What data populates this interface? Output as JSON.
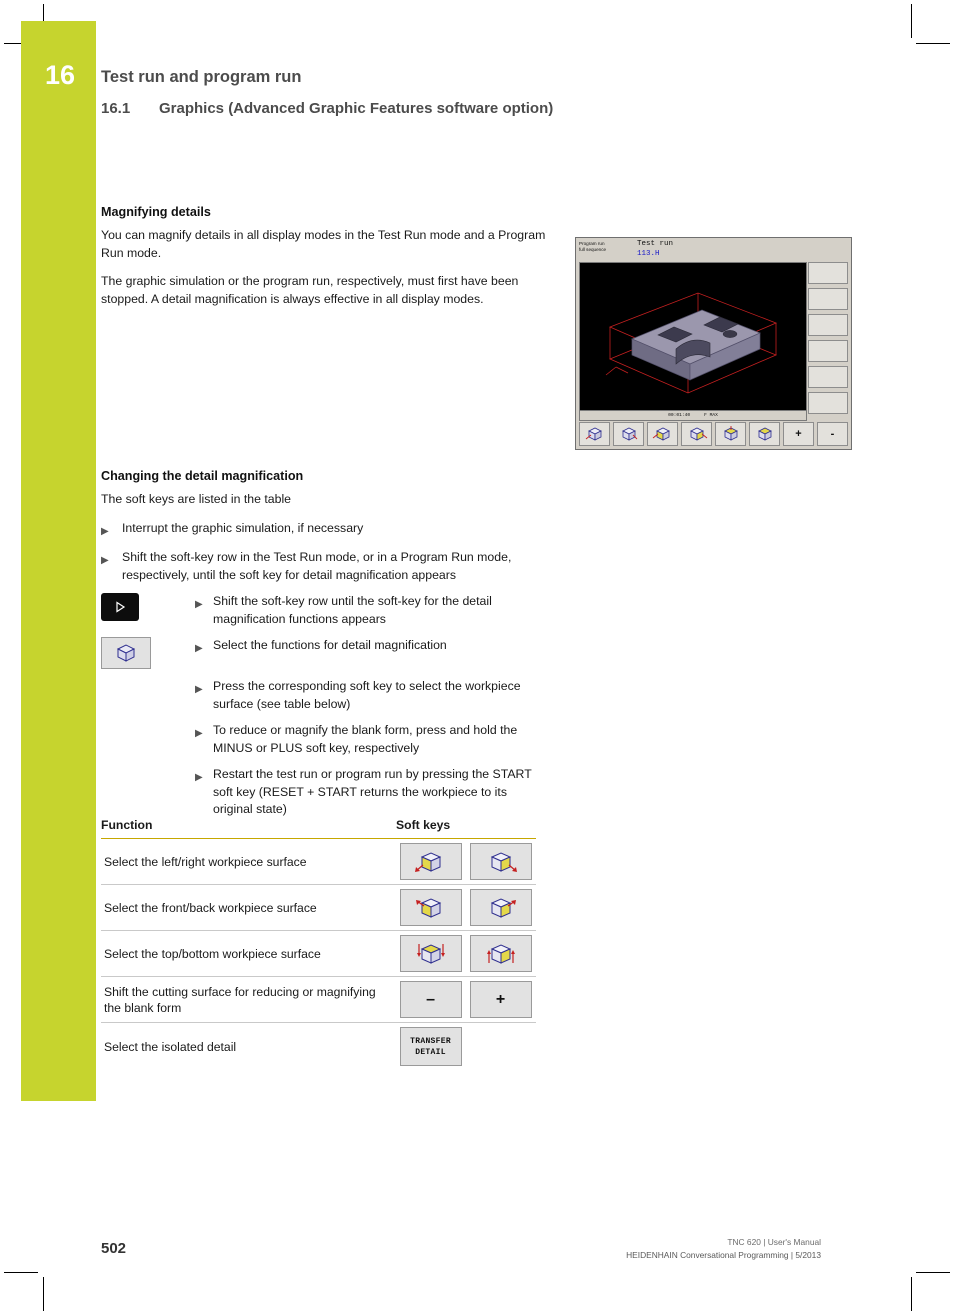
{
  "chapter": {
    "number": "16",
    "title": "Test run and program run",
    "section_number": "16.1",
    "section_title": "Graphics (Advanced Graphic Features software option)"
  },
  "content": {
    "heading1": "Magnifying details",
    "para1": "You can magnify details in all display modes in the Test Run mode and a Program Run mode.",
    "para2": "The graphic simulation or the program run, respectively, must first have been stopped. A detail magnification is always effective in all display modes.",
    "heading2": "Changing the detail magnification",
    "para3": "The soft keys are listed in the table",
    "bullets": [
      "Interrupt the graphic simulation, if necessary",
      "Shift the soft-key row in the Test Run mode, or in a Program Run mode, respectively, until the soft key for detail magnification appears"
    ],
    "icon_bullets": [
      "Shift the soft-key row until the soft-key for the detail magnification functions appears",
      "Select the functions for detail magnification",
      "Press the corresponding soft key to select the workpiece surface (see table below)",
      "To reduce or magnify the blank form, press and hold the MINUS or PLUS soft key, respectively",
      "Restart the test run or program run by pressing the START soft key (RESET + START returns the workpiece to its original state)"
    ]
  },
  "table": {
    "header": {
      "function": "Function",
      "softkeys": "Soft keys"
    },
    "rows": [
      {
        "function": "Select the left/right workpiece surface",
        "keys": [
          "cube-left-icon",
          "cube-right-icon"
        ]
      },
      {
        "function": "Select the front/back workpiece surface",
        "keys": [
          "cube-front-icon",
          "cube-back-icon"
        ]
      },
      {
        "function": "Select the top/bottom workpiece surface",
        "keys": [
          "cube-top-icon",
          "cube-bottom-icon"
        ]
      },
      {
        "function": "Shift the cutting surface for reducing or magnifying the blank form",
        "keys": [
          "minus",
          "plus"
        ],
        "labels": [
          "–",
          "+"
        ]
      },
      {
        "function": "Select the isolated detail",
        "keys": [
          "transfer-detail"
        ],
        "labels": [
          "TRANSFER",
          "DETAIL"
        ]
      }
    ]
  },
  "tnc_screen": {
    "mode_line1": "Program run",
    "mode_line2": "full sequence",
    "title_line1": "Test run",
    "title_line2": "113.H",
    "status_left": "00:01:40",
    "status_right": "F  MAX",
    "softkeys": [
      "view-icon-1",
      "view-icon-2",
      "cube-left-icon",
      "cube-front-icon",
      "cube-top-icon",
      "cube-iso-icon",
      "+",
      "-"
    ]
  },
  "footer": {
    "page_number": "502",
    "line1": "TNC 620 | User's Manual",
    "line2": "HEIDENHAIN Conversational Programming | 5/2013"
  }
}
